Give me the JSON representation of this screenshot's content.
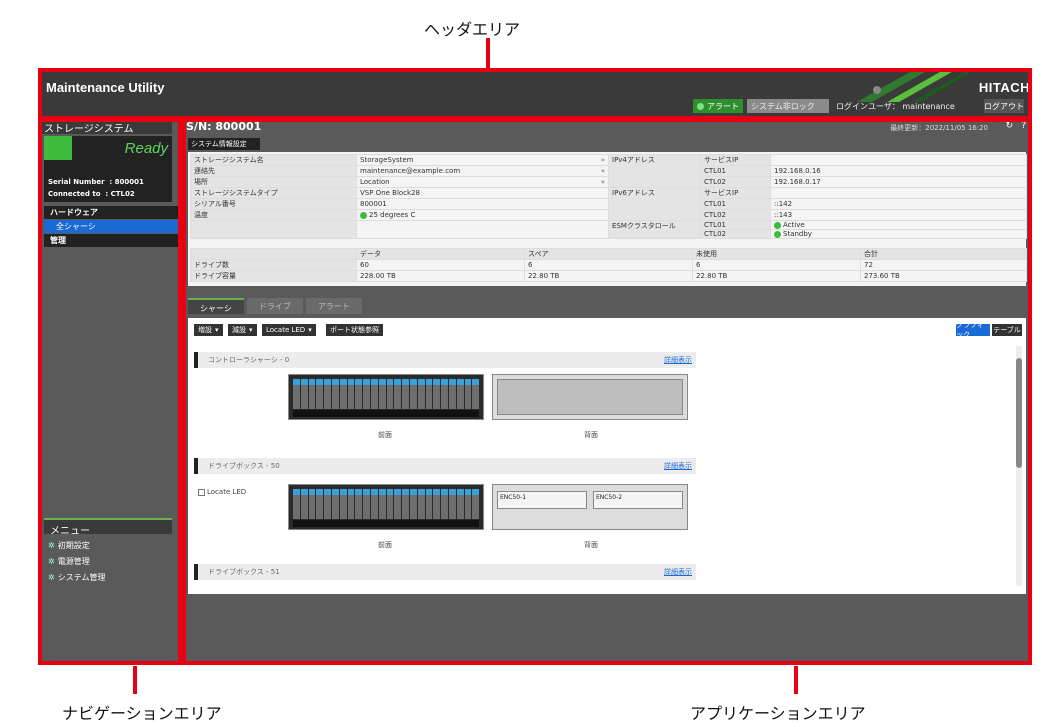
{
  "callouts": {
    "header": "ヘッダエリア",
    "navigation": "ナビゲーションエリア",
    "application": "アプリケーションエリア"
  },
  "header": {
    "title": "Maintenance Utility",
    "brand": "HITACH",
    "alert_label": "アラート",
    "system_lock_label": "システム非ロック",
    "login_user": "ログインユーザ： maintenance",
    "logout_label": "ログアウト"
  },
  "nav": {
    "title": "ストレージシステム",
    "status": "Ready",
    "serial_label": "Serial Number",
    "serial_value": ": 800001",
    "connected_label": "Connected to",
    "connected_value": ": CTL02",
    "hardware": "ハードウェア",
    "all_chassis": "全シャーシ",
    "management": "管理",
    "menu_title": "メニュー",
    "menu_items": [
      "初期設定",
      "電源管理",
      "システム管理"
    ]
  },
  "app": {
    "sn": "S/N: 800001",
    "updated": "最終更新：2022/11/05 16:20",
    "refresh_icon": "refresh-icon",
    "help_icon": "help-icon",
    "sysinfo_button": "システム情報設定",
    "info": {
      "rows": [
        {
          "label": "ストレージシステム名",
          "value": "StorageSystem"
        },
        {
          "label": "連絡先",
          "value": "maintenance@example.com"
        },
        {
          "label": "場所",
          "value": "Location"
        },
        {
          "label": "ストレージシステムタイプ",
          "value": "VSP One Block28"
        },
        {
          "label": "シリアル番号",
          "value": "800001"
        },
        {
          "label": "温度",
          "value": "25 degrees C"
        }
      ],
      "ipv4_label": "IPv4アドレス",
      "ipv6_label": "IPv6アドレス",
      "esm_label": "ESMクラスタロール",
      "service_ip": "サービスIP",
      "ctl01": "CTL01",
      "ctl02": "CTL02",
      "ipv4_ctl01": "192.168.0.16",
      "ipv4_ctl02": "192.168.0.17",
      "ipv6_ctl01": "::142",
      "ipv6_ctl02": "::143",
      "esm_ctl01": "Active",
      "esm_ctl02": "Standby"
    },
    "drives": {
      "headers": [
        "データ",
        "スペア",
        "未使用",
        "合計"
      ],
      "count_label": "ドライブ数",
      "capacity_label": "ドライブ容量",
      "counts": [
        "60",
        "6",
        "6",
        "72"
      ],
      "capacities": [
        "228.00 TB",
        "22.80 TB",
        "22.80 TB",
        "273.60 TB"
      ]
    },
    "tabs": [
      "シャーシ",
      "ドライブ",
      "アラート"
    ],
    "toolbar": {
      "add": "増設",
      "remove": "減設",
      "locate": "Locate LED",
      "port": "ポート状態参照",
      "graphic": "グラフィック",
      "table": "テーブル"
    },
    "boxes": [
      {
        "name": "コントローラシャーシ - 0",
        "detail": "詳細表示",
        "front": "前面",
        "rear": "背面"
      },
      {
        "name": "ドライブボックス - 50",
        "detail": "詳細表示",
        "front": "前面",
        "rear": "背面",
        "locate_led": "Locate LED",
        "enc1": "ENC50-1",
        "enc2": "ENC50-2"
      },
      {
        "name": "ドライブボックス - 51",
        "detail": "詳細表示"
      }
    ]
  }
}
